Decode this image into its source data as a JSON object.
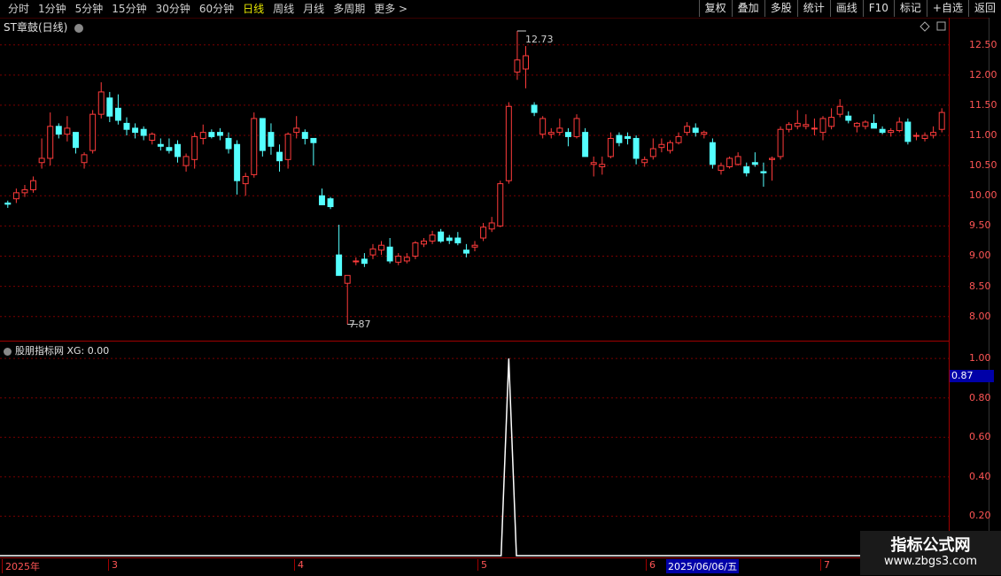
{
  "toolbar": {
    "left": [
      "分时",
      "1分钟",
      "5分钟",
      "15分钟",
      "30分钟",
      "60分钟",
      "日线",
      "周线",
      "月线",
      "多周期",
      "更多 >"
    ],
    "active_index": 6,
    "right": [
      "复权",
      "叠加",
      "多股",
      "统计",
      "画线",
      "F10",
      "标记",
      "+自选",
      "返回"
    ]
  },
  "main_title": "ST章鼓(日线)",
  "indicator_title": "股朋指标网 XG: 0.00",
  "price_axis": [
    "12.50",
    "12.00",
    "11.50",
    "11.00",
    "10.50",
    "10.00",
    "9.50",
    "9.00",
    "8.50",
    "8.00"
  ],
  "indicator_axis": [
    "1.00",
    "0.80",
    "0.60",
    "0.40",
    "0.20"
  ],
  "indicator_value_tag": "0.87",
  "high_marker": "12.73",
  "low_marker": "7.87",
  "x_axis": {
    "labels": [
      "2025年",
      "3",
      "4",
      "5",
      "6",
      "7"
    ],
    "selected_date": "2025/06/06/五"
  },
  "watermark": {
    "line1": "指标公式网",
    "line2": "www.zbgs3.com"
  },
  "colors": {
    "up": "#ff3b3b",
    "down": "#54ffff",
    "grid": "#7a0000",
    "indicator_line": "#ffffff"
  },
  "chart_data": {
    "type": "candlestick",
    "ylim": [
      7.6,
      12.95
    ],
    "candles": [
      [
        9.88,
        9.92,
        9.8,
        9.86
      ],
      [
        9.95,
        10.12,
        9.88,
        10.05
      ],
      [
        10.05,
        10.18,
        9.98,
        10.1
      ],
      [
        10.1,
        10.32,
        10.05,
        10.25
      ],
      [
        10.55,
        10.95,
        10.45,
        10.62
      ],
      [
        10.62,
        11.38,
        10.5,
        11.15
      ],
      [
        11.15,
        11.2,
        10.95,
        11.02
      ],
      [
        11.02,
        11.32,
        10.9,
        11.12
      ],
      [
        11.05,
        11.05,
        10.7,
        10.8
      ],
      [
        10.55,
        10.72,
        10.45,
        10.68
      ],
      [
        10.75,
        11.42,
        10.7,
        11.35
      ],
      [
        11.35,
        11.88,
        11.28,
        11.72
      ],
      [
        11.62,
        11.72,
        11.22,
        11.32
      ],
      [
        11.45,
        11.68,
        11.18,
        11.25
      ],
      [
        11.2,
        11.3,
        11.0,
        11.1
      ],
      [
        11.12,
        11.2,
        10.95,
        11.05
      ],
      [
        11.1,
        11.15,
        10.92,
        11.0
      ],
      [
        10.92,
        11.05,
        10.85,
        11.02
      ],
      [
        10.85,
        10.95,
        10.75,
        10.82
      ],
      [
        10.8,
        10.95,
        10.7,
        10.75
      ],
      [
        10.85,
        10.92,
        10.55,
        10.65
      ],
      [
        10.5,
        10.7,
        10.4,
        10.65
      ],
      [
        10.6,
        11.05,
        10.45,
        10.98
      ],
      [
        10.95,
        11.18,
        10.85,
        11.05
      ],
      [
        11.05,
        11.1,
        10.95,
        10.98
      ],
      [
        11.05,
        11.12,
        10.92,
        11.0
      ],
      [
        10.95,
        11.05,
        10.7,
        10.78
      ],
      [
        10.85,
        10.92,
        10.02,
        10.25
      ],
      [
        10.2,
        10.38,
        10.0,
        10.32
      ],
      [
        10.35,
        11.38,
        10.3,
        11.28
      ],
      [
        11.28,
        11.28,
        10.65,
        10.75
      ],
      [
        11.05,
        11.2,
        10.68,
        10.82
      ],
      [
        10.72,
        10.85,
        10.4,
        10.58
      ],
      [
        10.6,
        11.05,
        10.45,
        11.02
      ],
      [
        11.05,
        11.32,
        10.95,
        11.12
      ],
      [
        11.05,
        11.1,
        10.85,
        10.95
      ],
      [
        10.95,
        10.95,
        10.5,
        10.88
      ],
      [
        10.0,
        10.12,
        9.85,
        9.85
      ],
      [
        9.95,
        9.98,
        9.78,
        9.82
      ],
      [
        9.02,
        9.52,
        8.68,
        8.68
      ],
      [
        8.55,
        8.68,
        7.87,
        8.68
      ],
      [
        8.92,
        8.98,
        8.85,
        8.92
      ],
      [
        8.95,
        9.05,
        8.82,
        8.88
      ],
      [
        9.02,
        9.2,
        8.95,
        9.12
      ],
      [
        9.1,
        9.25,
        9.02,
        9.18
      ],
      [
        9.15,
        9.3,
        8.88,
        8.92
      ],
      [
        8.9,
        9.05,
        8.85,
        9.0
      ],
      [
        8.92,
        9.05,
        8.88,
        8.98
      ],
      [
        9.0,
        9.25,
        8.95,
        9.22
      ],
      [
        9.2,
        9.3,
        9.15,
        9.25
      ],
      [
        9.25,
        9.42,
        9.2,
        9.35
      ],
      [
        9.4,
        9.45,
        9.22,
        9.25
      ],
      [
        9.3,
        9.35,
        9.2,
        9.26
      ],
      [
        9.3,
        9.4,
        9.18,
        9.22
      ],
      [
        9.1,
        9.2,
        8.98,
        9.05
      ],
      [
        9.15,
        9.25,
        9.08,
        9.18
      ],
      [
        9.3,
        9.55,
        9.25,
        9.48
      ],
      [
        9.45,
        9.65,
        9.4,
        9.55
      ],
      [
        9.5,
        10.25,
        9.48,
        10.2
      ],
      [
        10.25,
        11.55,
        10.2,
        11.48
      ],
      [
        12.05,
        12.73,
        11.92,
        12.25
      ],
      [
        12.1,
        12.48,
        11.78,
        12.32
      ],
      [
        11.5,
        11.55,
        11.32,
        11.38
      ],
      [
        11.02,
        11.32,
        10.95,
        11.28
      ],
      [
        11.02,
        11.12,
        10.95,
        11.05
      ],
      [
        11.05,
        11.28,
        11.0,
        11.12
      ],
      [
        11.05,
        11.12,
        10.82,
        10.98
      ],
      [
        10.98,
        11.35,
        10.95,
        11.28
      ],
      [
        11.05,
        11.12,
        10.65,
        10.65
      ],
      [
        10.52,
        10.65,
        10.32,
        10.55
      ],
      [
        10.48,
        10.65,
        10.35,
        10.52
      ],
      [
        10.65,
        11.05,
        10.62,
        10.95
      ],
      [
        11.0,
        11.05,
        10.82,
        10.88
      ],
      [
        10.98,
        11.05,
        10.85,
        10.95
      ],
      [
        10.95,
        11.0,
        10.52,
        10.62
      ],
      [
        10.55,
        10.65,
        10.48,
        10.6
      ],
      [
        10.65,
        10.95,
        10.6,
        10.78
      ],
      [
        10.8,
        10.95,
        10.72,
        10.85
      ],
      [
        10.75,
        10.92,
        10.7,
        10.88
      ],
      [
        10.88,
        11.05,
        10.85,
        10.98
      ],
      [
        11.05,
        11.22,
        11.0,
        11.15
      ],
      [
        11.12,
        11.2,
        10.98,
        11.05
      ],
      [
        11.02,
        11.08,
        10.95,
        11.05
      ],
      [
        10.88,
        10.95,
        10.45,
        10.52
      ],
      [
        10.42,
        10.55,
        10.35,
        10.5
      ],
      [
        10.48,
        10.65,
        10.45,
        10.62
      ],
      [
        10.52,
        10.72,
        10.5,
        10.65
      ],
      [
        10.48,
        10.55,
        10.32,
        10.38
      ],
      [
        10.55,
        10.72,
        10.48,
        10.52
      ],
      [
        10.4,
        10.55,
        10.15,
        10.38
      ],
      [
        10.6,
        10.65,
        10.25,
        10.62
      ],
      [
        10.65,
        11.15,
        10.6,
        11.1
      ],
      [
        11.1,
        11.22,
        11.05,
        11.18
      ],
      [
        11.15,
        11.42,
        11.1,
        11.2
      ],
      [
        11.15,
        11.35,
        11.1,
        11.18
      ],
      [
        11.12,
        11.28,
        11.0,
        11.12
      ],
      [
        11.05,
        11.32,
        10.92,
        11.28
      ],
      [
        11.15,
        11.45,
        11.1,
        11.3
      ],
      [
        11.35,
        11.6,
        11.3,
        11.48
      ],
      [
        11.32,
        11.4,
        11.2,
        11.25
      ],
      [
        11.15,
        11.22,
        11.05,
        11.2
      ],
      [
        11.15,
        11.25,
        11.1,
        11.22
      ],
      [
        11.2,
        11.35,
        11.15,
        11.12
      ],
      [
        11.1,
        11.15,
        11.02,
        11.05
      ],
      [
        11.05,
        11.12,
        10.98,
        11.08
      ],
      [
        11.08,
        11.3,
        11.05,
        11.22
      ],
      [
        11.22,
        11.28,
        10.85,
        10.9
      ],
      [
        11.0,
        11.05,
        10.92,
        11.0
      ],
      [
        10.95,
        11.05,
        10.9,
        11.0
      ],
      [
        11.0,
        11.15,
        10.95,
        11.05
      ],
      [
        11.1,
        11.45,
        11.05,
        11.38
      ]
    ],
    "indicator": {
      "name": "XG",
      "spike_index": 59,
      "spike_value": 1.0,
      "baseline": 0.0,
      "ylim": [
        0,
        1.05
      ]
    }
  }
}
